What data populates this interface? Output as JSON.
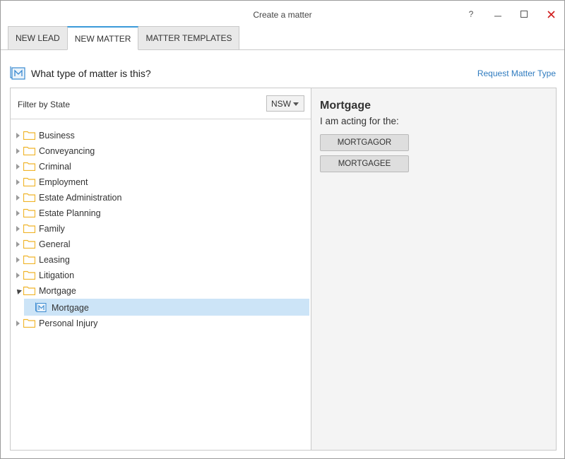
{
  "window": {
    "title": "Create a matter"
  },
  "titlebar": {
    "help": "?"
  },
  "tabs": [
    {
      "label": "NEW LEAD",
      "active": false
    },
    {
      "label": "NEW MATTER",
      "active": true
    },
    {
      "label": "MATTER TEMPLATES",
      "active": false
    }
  ],
  "header": {
    "question": "What type of matter is this?",
    "request_link": "Request Matter Type"
  },
  "filter": {
    "label": "Filter by State",
    "selected_state": "NSW"
  },
  "tree": {
    "items": [
      {
        "label": "Business"
      },
      {
        "label": "Conveyancing"
      },
      {
        "label": "Criminal"
      },
      {
        "label": "Employment"
      },
      {
        "label": "Estate Administration"
      },
      {
        "label": "Estate Planning"
      },
      {
        "label": "Family"
      },
      {
        "label": "General"
      },
      {
        "label": "Leasing"
      },
      {
        "label": "Litigation"
      },
      {
        "label": "Mortgage",
        "expanded": true,
        "child": "Mortgage"
      },
      {
        "label": "Personal Injury"
      }
    ]
  },
  "detail": {
    "title": "Mortgage",
    "subtitle": "I am acting for the:",
    "buttons": [
      "MORTGAGOR",
      "MORTGAGEE"
    ]
  },
  "colors": {
    "accent": "#3a9ad9",
    "link": "#2f7bbf",
    "selection": "#cce4f7",
    "folder": "#f0b429",
    "close": "#d01c1c"
  }
}
